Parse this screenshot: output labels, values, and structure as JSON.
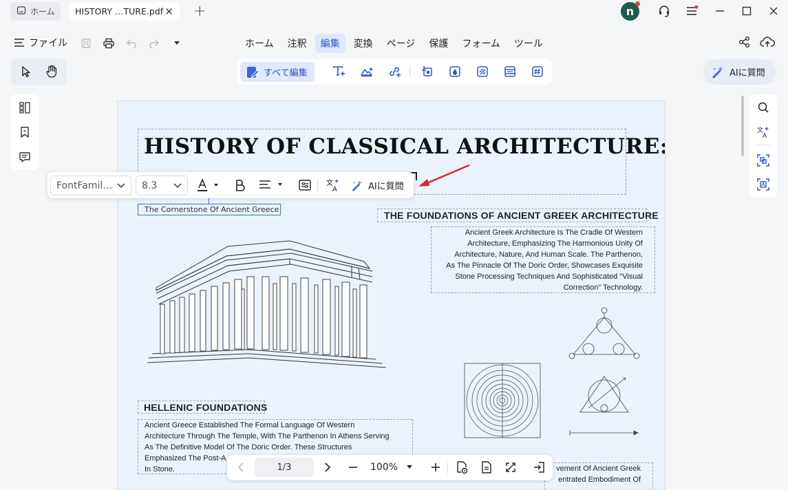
{
  "tabs": {
    "home_label": "ホーム",
    "doc_label": "HISTORY …TURE.pdf"
  },
  "user": {
    "avatar_letter": "n"
  },
  "menu": {
    "file_label": "ファイル",
    "items": [
      "ホーム",
      "注釈",
      "編集",
      "変換",
      "ページ",
      "保護",
      "フォーム",
      "ツール"
    ],
    "active": "編集"
  },
  "toolbar": {
    "edit_all_label": "すべて編集",
    "ai_label": "AIに質問"
  },
  "text_toolbar": {
    "font_family": "FontFamil…",
    "font_size": "8.3",
    "ai_label": "AIに質問"
  },
  "document": {
    "title": "HISTORY OF CLASSICAL  ARCHITECTURE:",
    "subtitle": "The Cornerstone Of Ancient Greece",
    "section1_heading": "THE FOUNDATIONS OF ANCIENT GREEK ARCHITECTURE",
    "section1_lines": [
      "Ancient Greek Architecture Is The Cradle Of Western",
      "Architecture, Emphasizing The Harmonious Unity Of",
      "Architecture, Nature, And Human Scale. The Parthenon,",
      "As The Pinnacle Of The Doric Order, Showcases Exquisite",
      "Stone Processing Techniques And Sophisticated \"Visual",
      "Correction\" Technology."
    ],
    "section2_heading": "HELLENIC FOUNDATIONS",
    "section2_lines": [
      "Ancient Greece Established The Formal Language Of Western",
      "Architecture Through The Temple, With The Parthenon In Athens Serving",
      "As The Definitive Model Of The Doric Order. These Structures",
      "Emphasized The Post-A",
      "In Stone."
    ],
    "section3_lines": [
      "vement Of Ancient Greek",
      "entrated Embodiment Of"
    ]
  },
  "navigation": {
    "page_indicator": "1/3",
    "zoom": "100%"
  },
  "colors": {
    "accent": "#2a56d1",
    "active_bg": "#e0e8fb",
    "page_bg": "#eaf3fb",
    "avatar": "#1f5a4d",
    "arrow": "#e0262e"
  }
}
